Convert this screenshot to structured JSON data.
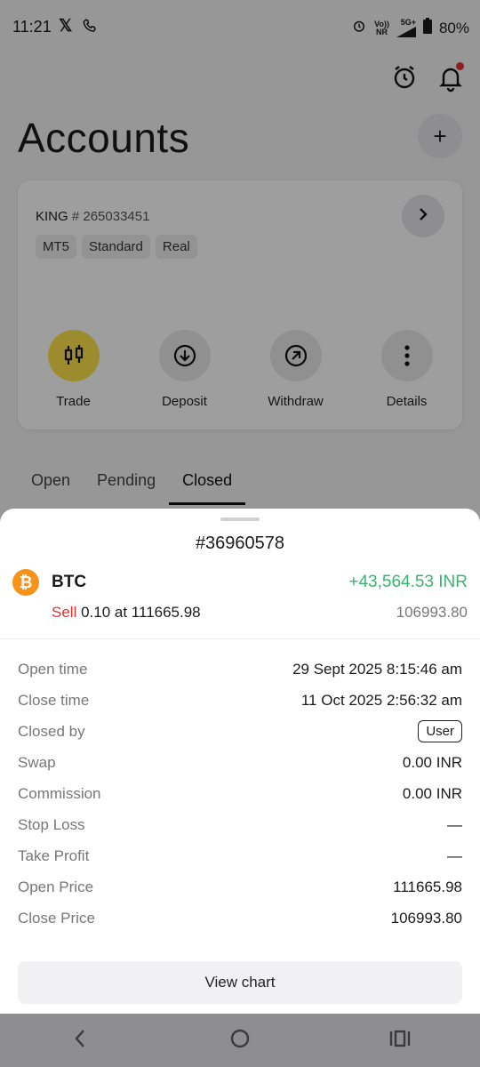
{
  "status_bar": {
    "time": "11:21",
    "x_label": "𝕏",
    "network_top": "Vo))",
    "network_bottom": "NR",
    "signal_label": "5G+",
    "battery": "80%"
  },
  "header": {
    "title": "Accounts",
    "add_label": "+"
  },
  "account": {
    "name": "KING",
    "number": "# 265033451",
    "tags": [
      "MT5",
      "Standard",
      "Real"
    ],
    "actions": [
      {
        "label": "Trade",
        "icon": "candlestick-icon"
      },
      {
        "label": "Deposit",
        "icon": "deposit-icon"
      },
      {
        "label": "Withdraw",
        "icon": "withdraw-icon"
      },
      {
        "label": "Details",
        "icon": "more-vertical-icon"
      }
    ]
  },
  "tabs": [
    "Open",
    "Pending",
    "Closed"
  ],
  "active_tab": "Closed",
  "order": {
    "id": "#36960578",
    "coin_glyph": "₿",
    "symbol": "BTC",
    "profit": "+43,564.53 INR",
    "side": "Sell",
    "volume_text": "0.10 at 111665.98",
    "close_price": "106993.80",
    "details": [
      {
        "label": "Open time",
        "value": "29 Sept 2025 8:15:46 am"
      },
      {
        "label": "Close time",
        "value": "11 Oct 2025 2:56:32 am"
      },
      {
        "label": "Closed by",
        "value": "User",
        "badge": true
      },
      {
        "label": "Swap",
        "value": "0.00 INR"
      },
      {
        "label": "Commission",
        "value": "0.00 INR"
      },
      {
        "label": "Stop Loss",
        "value": "—"
      },
      {
        "label": "Take Profit",
        "value": "—"
      },
      {
        "label": "Open Price",
        "value": "111665.98"
      },
      {
        "label": "Close Price",
        "value": "106993.80"
      }
    ],
    "view_chart_label": "View chart"
  },
  "colors": {
    "profit": "#3cb371",
    "sell": "#e0322e",
    "trade_accent": "#fde34b",
    "btc": "#f7931a"
  }
}
